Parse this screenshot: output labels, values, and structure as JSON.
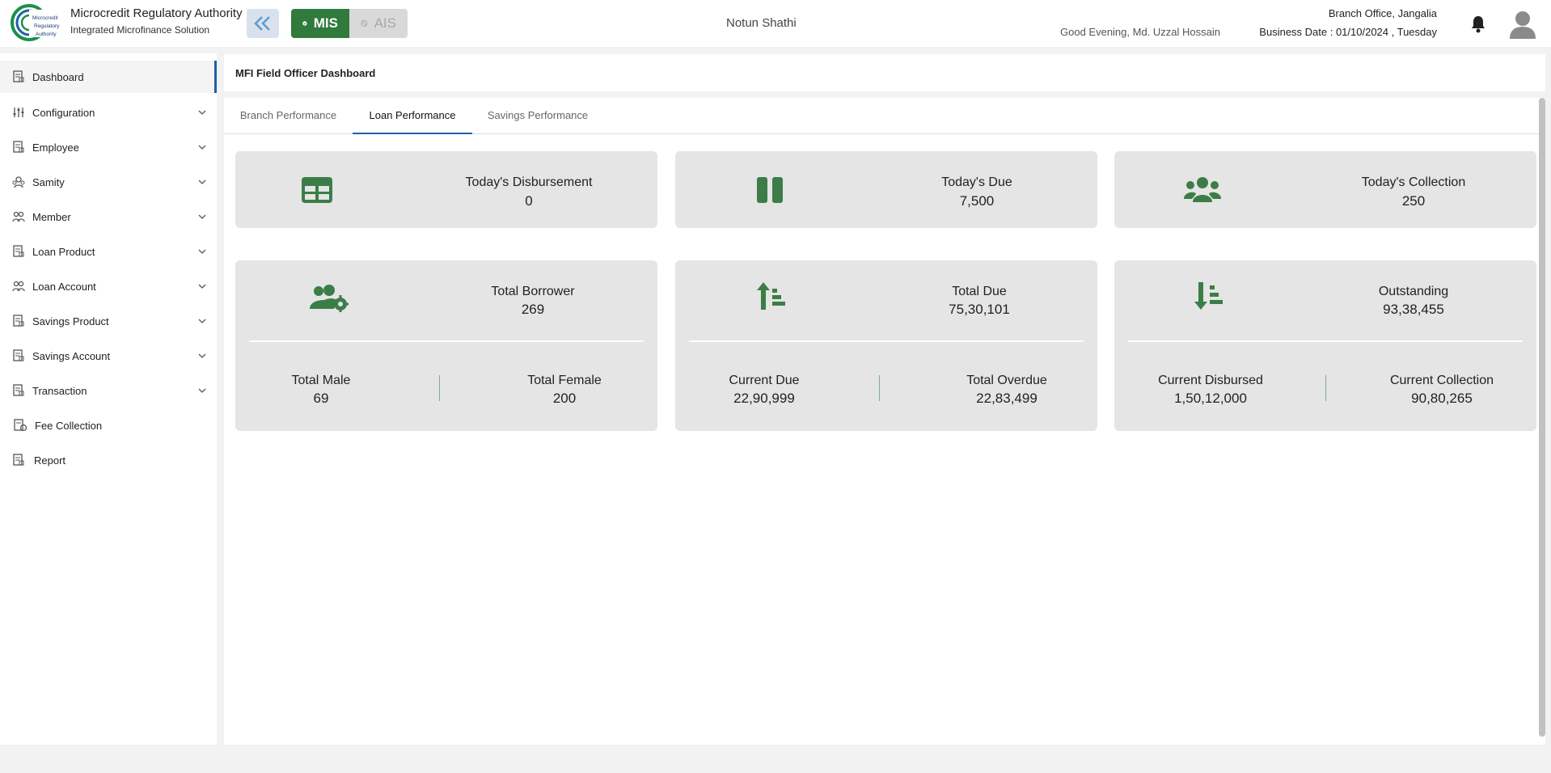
{
  "header": {
    "org_name": "Microcredit Regulatory Authority",
    "subtitle": "Integrated Microfinance Solution",
    "logo_text": "Microcredit Regulatory Authority",
    "mode_mis": "MIS",
    "mode_ais": "AIS",
    "center_title": "Notun Shathi",
    "greeting": "Good Evening, Md. Uzzal Hossain",
    "branch": "Branch Office, Jangalia",
    "business_date": "Business Date : 01/10/2024 , Tuesday"
  },
  "sidebar": {
    "items": [
      {
        "label": "Dashboard",
        "icon": "dashboard-icon",
        "expandable": false,
        "active": true
      },
      {
        "label": "Configuration",
        "icon": "sliders-icon",
        "expandable": true
      },
      {
        "label": "Employee",
        "icon": "employee-icon",
        "expandable": true
      },
      {
        "label": "Samity",
        "icon": "samity-icon",
        "expandable": true
      },
      {
        "label": "Member",
        "icon": "member-icon",
        "expandable": true
      },
      {
        "label": "Loan Product",
        "icon": "loan-product-icon",
        "expandable": true
      },
      {
        "label": "Loan Account",
        "icon": "loan-account-icon",
        "expandable": true
      },
      {
        "label": "Savings Product",
        "icon": "savings-product-icon",
        "expandable": true
      },
      {
        "label": "Savings Account",
        "icon": "savings-account-icon",
        "expandable": true
      },
      {
        "label": "Transaction",
        "icon": "transaction-icon",
        "expandable": true
      },
      {
        "label": "Fee Collection",
        "icon": "fee-collection-icon",
        "expandable": false
      },
      {
        "label": "Report",
        "icon": "report-icon",
        "expandable": false
      }
    ]
  },
  "page": {
    "title": "MFI Field Officer Dashboard",
    "tabs": [
      {
        "label": "Branch Performance",
        "active": false
      },
      {
        "label": "Loan Performance",
        "active": true
      },
      {
        "label": "Savings Performance",
        "active": false
      }
    ]
  },
  "cards": {
    "disbursement": {
      "title": "Today's Disbursement",
      "value": "0",
      "icon": "table-icon"
    },
    "due": {
      "title": "Today's Due",
      "value": "7,500",
      "icon": "pause-icon"
    },
    "collection": {
      "title": "Today's Collection",
      "value": "250",
      "icon": "users-icon"
    },
    "borrower": {
      "title": "Total Borrower",
      "value": "269",
      "icon": "users-gear-icon",
      "left_label": "Total Male",
      "left_value": "69",
      "right_label": "Total Female",
      "right_value": "200"
    },
    "total_due": {
      "title": "Total Due",
      "value": "75,30,101",
      "icon": "sort-up-icon",
      "left_label": "Current Due",
      "left_value": "22,90,999",
      "right_label": "Total Overdue",
      "right_value": "22,83,499"
    },
    "outstanding": {
      "title": "Outstanding",
      "value": "93,38,455",
      "icon": "sort-down-icon",
      "left_label": "Current Disbursed",
      "left_value": "1,50,12,000",
      "right_label": "Current Collection",
      "right_value": "90,80,265"
    }
  },
  "colors": {
    "accent_green": "#2f7a3c",
    "icon_green": "#3c7d47",
    "tab_active": "#1f5fa8",
    "card_bg": "#e4e5e4"
  }
}
